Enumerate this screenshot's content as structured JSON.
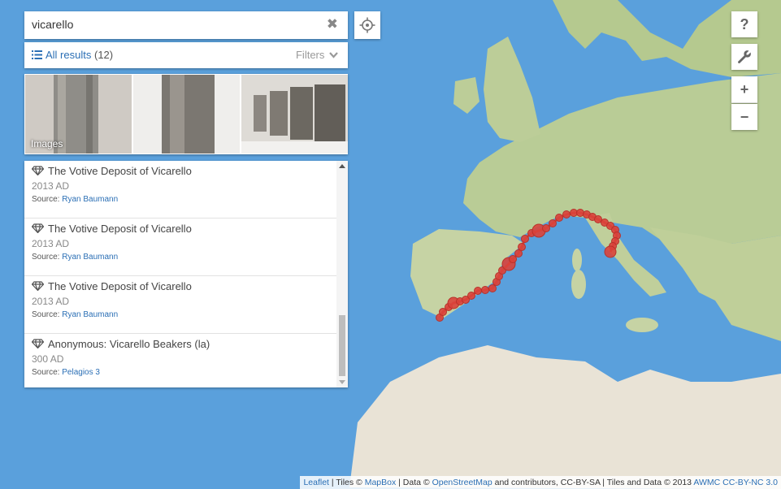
{
  "search": {
    "value": "vicarello",
    "clear_icon": "close-icon"
  },
  "results": {
    "label": "All results",
    "count": "(12)",
    "filters_label": "Filters"
  },
  "images": {
    "label": "Images"
  },
  "items": [
    {
      "title": "The Votive Deposit of Vicarello",
      "date": "2013 AD",
      "source_label": "Source:",
      "source": "Ryan Baumann"
    },
    {
      "title": "The Votive Deposit of Vicarello",
      "date": "2013 AD",
      "source_label": "Source:",
      "source": "Ryan Baumann"
    },
    {
      "title": "The Votive Deposit of Vicarello",
      "date": "2013 AD",
      "source_label": "Source:",
      "source": "Ryan Baumann"
    },
    {
      "title": "Anonymous: Vicarello Beakers (la)",
      "date": "300 AD",
      "source_label": "Source:",
      "source": "Pelagios 3"
    }
  ],
  "controls": {
    "help": "?",
    "zoom_in": "+",
    "zoom_out": "−"
  },
  "attribution": {
    "leaflet": "Leaflet",
    "tiles_prefix": "| Tiles ©",
    "mapbox": "MapBox",
    "data_prefix": "| Data ©",
    "osm": "OpenStreetMap",
    "middle": "and contributors, CC-BY-SA | Tiles and Data © 2013",
    "awmc": "AWMC CC-BY-NC 3.0"
  },
  "colors": {
    "sea": "#5aa0dc",
    "route": "#d9433b",
    "link": "#2b6fb5"
  }
}
